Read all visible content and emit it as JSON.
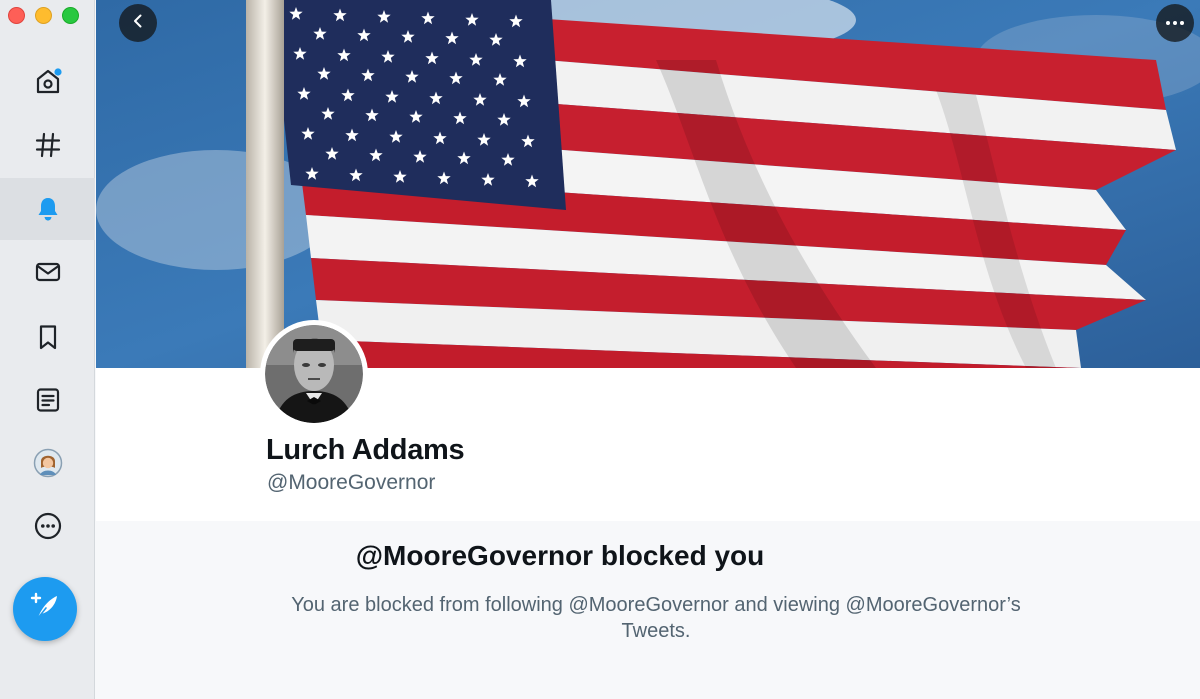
{
  "window": {
    "traffic_lights": [
      "close",
      "minimize",
      "maximize"
    ]
  },
  "sidebar": {
    "items": [
      {
        "id": "home",
        "icon": "home-icon",
        "notification_dot": true
      },
      {
        "id": "explore",
        "icon": "hashtag-icon"
      },
      {
        "id": "notifications",
        "icon": "bell-icon",
        "active": true
      },
      {
        "id": "messages",
        "icon": "envelope-icon"
      },
      {
        "id": "bookmarks",
        "icon": "bookmark-icon"
      },
      {
        "id": "lists",
        "icon": "list-icon"
      },
      {
        "id": "profile",
        "icon": "avatar-icon"
      },
      {
        "id": "more",
        "icon": "more-circle-icon"
      }
    ],
    "compose_icon": "compose-feather-icon",
    "accent_color": "#1d9bf0"
  },
  "header": {
    "back_icon": "chevron-left-icon",
    "more_icon": "ellipsis-icon"
  },
  "profile": {
    "display_name": "Lurch Addams",
    "handle": "@MooreGovernor",
    "banner": "american-flag"
  },
  "blocked": {
    "title": "@MooreGovernor blocked you",
    "description": "You are blocked from following @MooreGovernor and viewing @MooreGovernor’s Tweets."
  }
}
